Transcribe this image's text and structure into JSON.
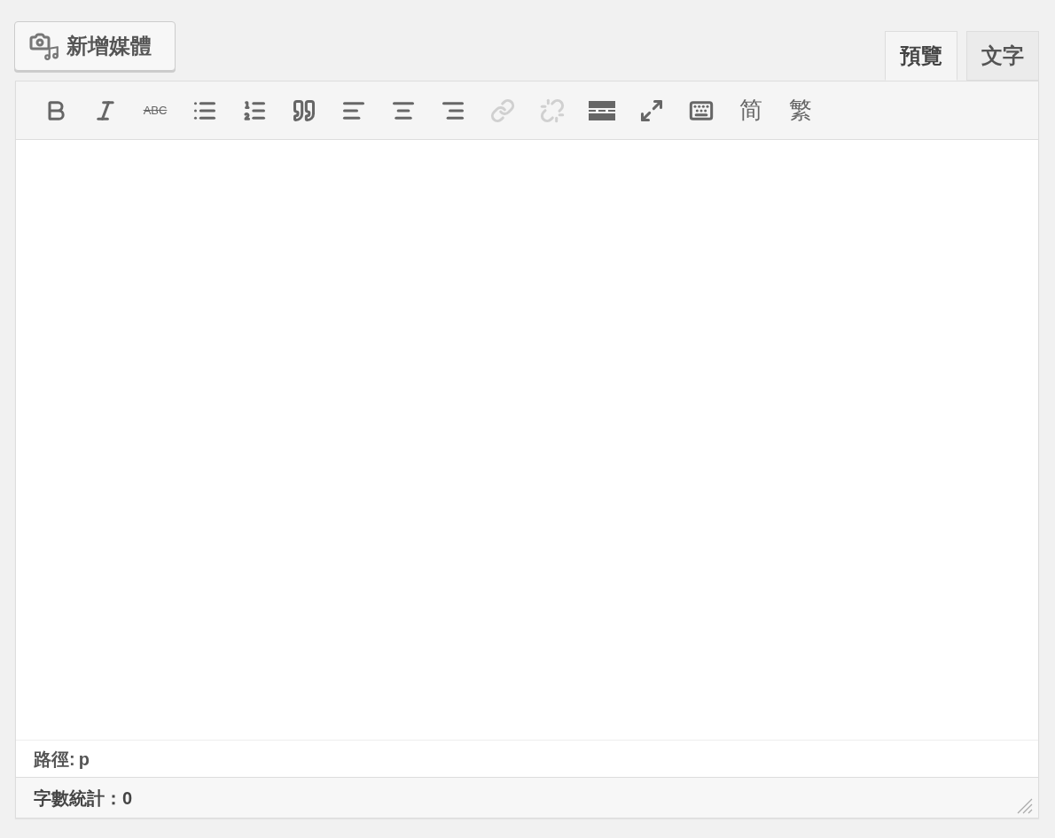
{
  "add_media_button": {
    "label": "新增媒體"
  },
  "tabs": [
    {
      "label": "預覽",
      "selected": true
    },
    {
      "label": "文字",
      "selected": false
    }
  ],
  "toolbar": [
    {
      "kind": "bold",
      "disabled": false
    },
    {
      "kind": "italic",
      "disabled": false
    },
    {
      "kind": "strikethrough",
      "label": "ABC",
      "disabled": false
    },
    {
      "kind": "bullet-list",
      "disabled": false
    },
    {
      "kind": "numbered-list",
      "disabled": false
    },
    {
      "kind": "blockquote",
      "disabled": false
    },
    {
      "kind": "align-left",
      "disabled": false
    },
    {
      "kind": "align-center",
      "disabled": false
    },
    {
      "kind": "align-right",
      "disabled": false
    },
    {
      "kind": "link",
      "disabled": true
    },
    {
      "kind": "unlink",
      "disabled": true
    },
    {
      "kind": "read-more",
      "disabled": false
    },
    {
      "kind": "fullscreen",
      "disabled": false
    },
    {
      "kind": "toolbar-toggle",
      "disabled": false
    },
    {
      "kind": "text",
      "label": "简",
      "disabled": false
    },
    {
      "kind": "text",
      "label": "繁",
      "disabled": false
    }
  ],
  "status_path": {
    "label": "路徑:",
    "element": "p"
  },
  "word_count": {
    "label": "字數統計：0"
  }
}
